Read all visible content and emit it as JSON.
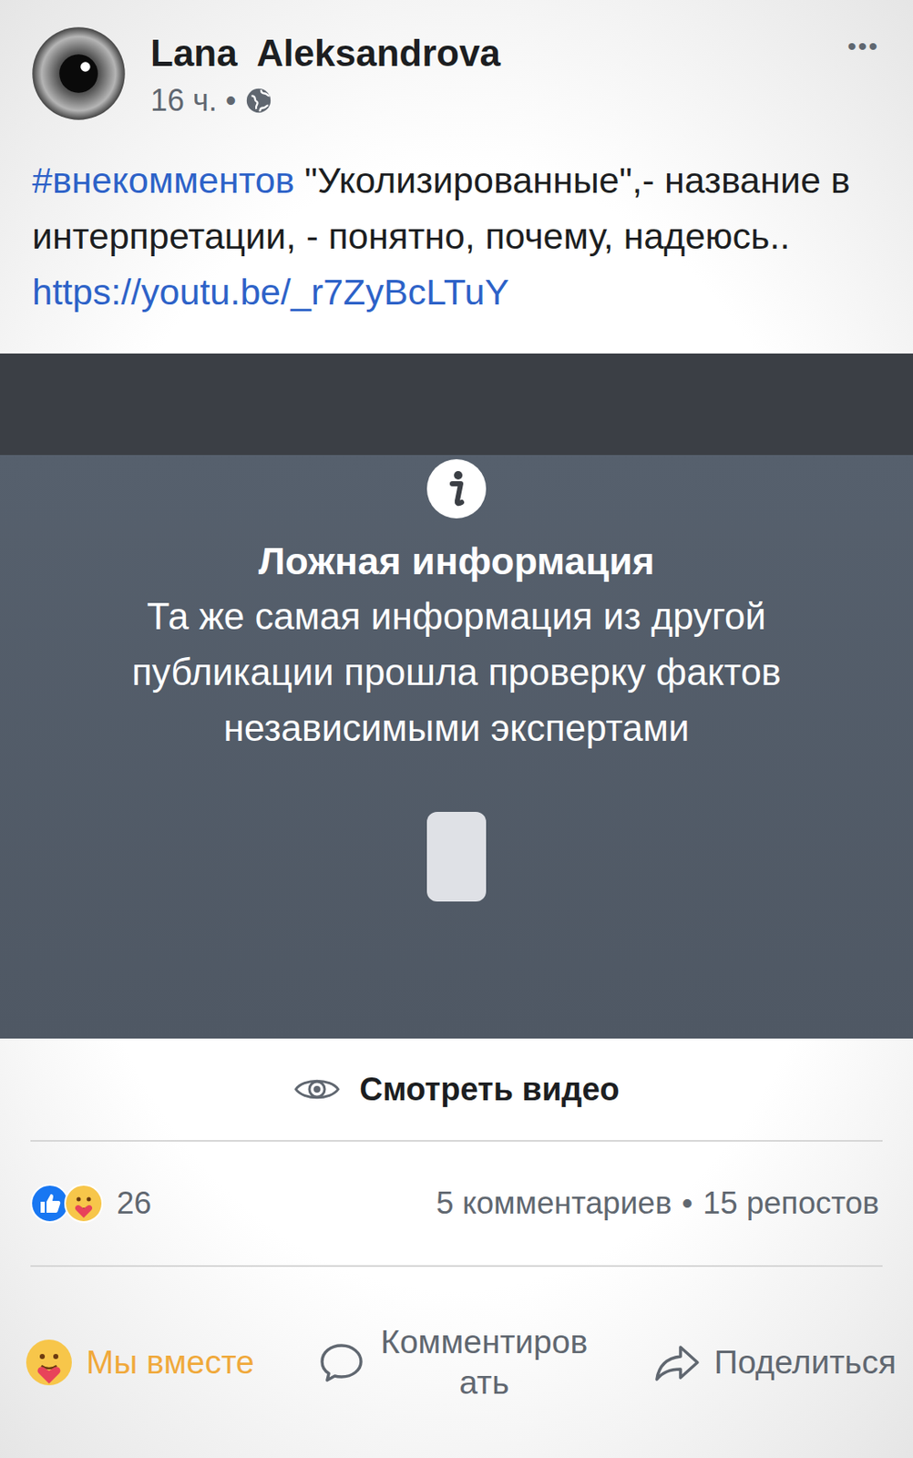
{
  "post": {
    "author": "Lana  Aleksandrova",
    "time": "16 ч.",
    "separator": "•",
    "menu": "•••",
    "hashtag": "#внекомментов",
    "body": " \"Уколизированные\",- название в интерпретации, - понятно, почему, надеюсь..",
    "link": "https://youtu.be/_r7ZyBcLTuY"
  },
  "warning": {
    "title": "Ложная информация",
    "message": "Та же самая информация из другой публикации прошла проверку фактов независимыми экспертами",
    "button": "Смотреть видео"
  },
  "stats": {
    "reactions": "26",
    "comments": "5 комментариев",
    "separator": "•",
    "shares": "15 репостов"
  },
  "actions": [
    {
      "label": "Мы вместе",
      "selected": true,
      "kind": "care"
    },
    {
      "label": "Комментировать",
      "selected": false,
      "kind": "comment"
    },
    {
      "label": "Поделиться",
      "selected": false,
      "kind": "share"
    }
  ]
}
